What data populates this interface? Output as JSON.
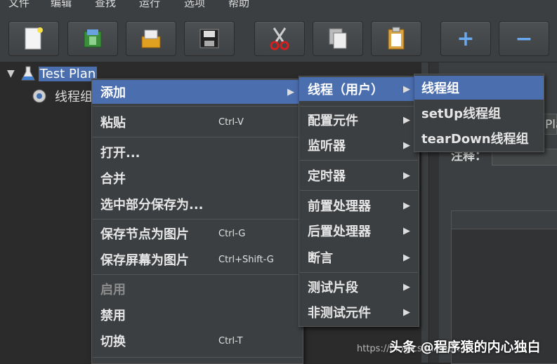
{
  "menubar": {
    "items": [
      "文件",
      "编辑",
      "查找",
      "运行",
      "选项",
      "帮助"
    ]
  },
  "toolbar": {
    "buttons": [
      {
        "icon": "new-document-icon"
      },
      {
        "icon": "templates-icon"
      },
      {
        "icon": "open-folder-icon"
      },
      {
        "icon": "save-icon"
      },
      {
        "icon": "cut-icon"
      },
      {
        "icon": "copy-icon"
      },
      {
        "icon": "paste-icon"
      },
      {
        "icon": "expand-plus-icon",
        "glyph": "+"
      },
      {
        "icon": "collapse-minus-icon",
        "glyph": "−"
      }
    ]
  },
  "tree": {
    "root": "Test Plan",
    "child": "线程组"
  },
  "context_menu": {
    "items": [
      {
        "label": "添加",
        "accel": "",
        "submenu": true
      },
      {
        "label": "粘贴",
        "accel": "Ctrl-V"
      },
      {
        "label": "打开...",
        "accel": ""
      },
      {
        "label": "合并",
        "accel": ""
      },
      {
        "label": "选中部分保存为...",
        "accel": ""
      },
      {
        "label": "保存节点为图片",
        "accel": "Ctrl-G"
      },
      {
        "label": "保存屏幕为图片",
        "accel": "Ctrl+Shift-G"
      },
      {
        "label": "启用",
        "accel": ""
      },
      {
        "label": "禁用",
        "accel": ""
      },
      {
        "label": "切换",
        "accel": "Ctrl-T"
      }
    ]
  },
  "add_submenu": {
    "items": [
      "线程（用户）",
      "配置元件",
      "监听器",
      "定时器",
      "前置处理器",
      "后置处理器",
      "断言",
      "测试片段",
      "非测试元件"
    ]
  },
  "threads_submenu": {
    "items": [
      "线程组",
      "setUp线程组",
      "tearDown线程组"
    ]
  },
  "right_panel": {
    "partial_label": "Pla",
    "comment_label": "注释："
  },
  "watermark": {
    "url": "https://blog.csdn.net/...",
    "text": "头条 @程序猿的内心独白"
  },
  "colors": {
    "selection": "#4b6eaf",
    "background": "#2b2b2b",
    "menu": "#3c3f41"
  }
}
